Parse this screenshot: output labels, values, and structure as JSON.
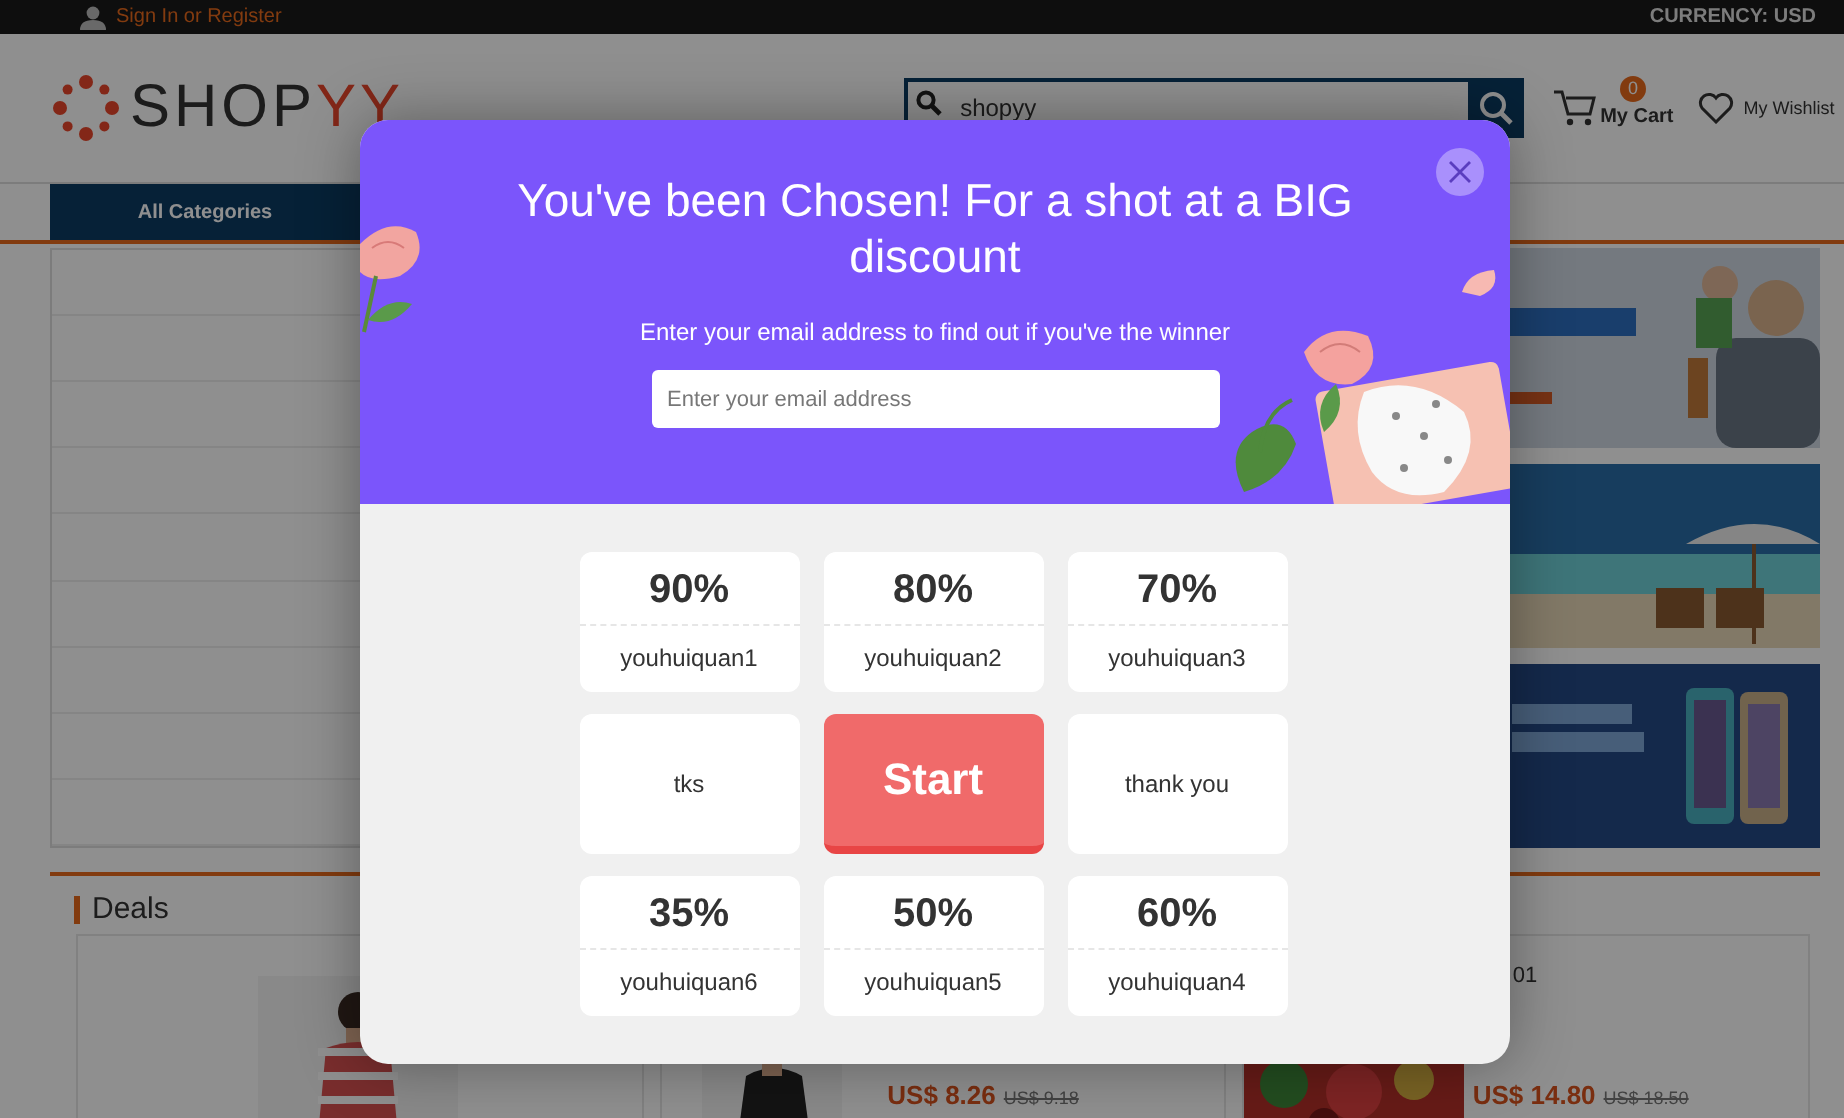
{
  "top_bar": {
    "account_link": "Sign In or Register",
    "currency": "CURRENCY: USD"
  },
  "header": {
    "logo": {
      "part_1": "SHOP",
      "part_2": "YY"
    },
    "search": {
      "value": "shopyy"
    },
    "cart": {
      "count": "0",
      "label": "My Cart"
    },
    "wishlist": "My Wishlist"
  },
  "nav": {
    "categories_button": "All Categories"
  },
  "deals": {
    "title": "Deals",
    "products": [
      {
        "price": "US$ 8.26",
        "old_price": "US$ 9.18"
      },
      {
        "text": "01",
        "price": "US$ 14.80",
        "old_price": "US$ 18.50"
      }
    ]
  },
  "popup": {
    "title": "You've been Chosen! For a shot at a BIG discount",
    "subtitle": "Enter your email address to find out if you've the winner",
    "email": {
      "placeholder": "Enter your email address"
    },
    "cells": [
      {
        "kind": "coupon",
        "percent": "90%",
        "name": "youhuiquan1"
      },
      {
        "kind": "coupon",
        "percent": "80%",
        "name": "youhuiquan2"
      },
      {
        "kind": "coupon",
        "percent": "70%",
        "name": "youhuiquan3"
      },
      {
        "kind": "text",
        "label": "tks"
      },
      {
        "kind": "start",
        "label": "Start"
      },
      {
        "kind": "text",
        "label": "thank you"
      },
      {
        "kind": "coupon",
        "percent": "35%",
        "name": "youhuiquan6"
      },
      {
        "kind": "coupon",
        "percent": "50%",
        "name": "youhuiquan5"
      },
      {
        "kind": "coupon",
        "percent": "60%",
        "name": "youhuiquan4"
      }
    ]
  }
}
